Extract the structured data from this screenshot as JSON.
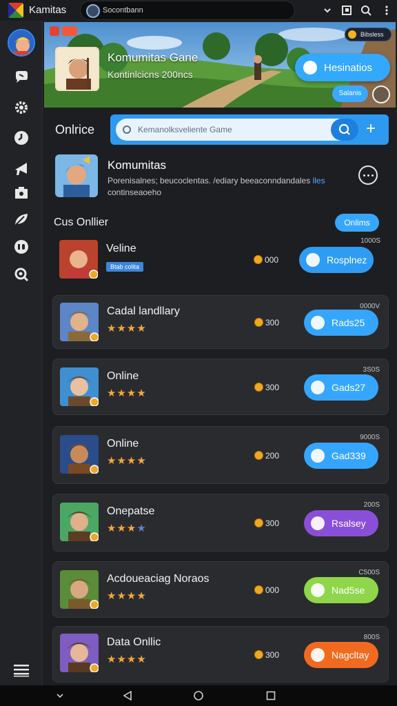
{
  "app": {
    "title": "Kamitas",
    "search_value": "Socontbann"
  },
  "hero": {
    "title": "Komumitas Gane",
    "subtitle": "Kontinlcicns 200ncs",
    "primary_button": "Hesinatios",
    "small_button": "Salanis",
    "coin_label": "Bibsless"
  },
  "search": {
    "section_label": "Onlrice",
    "placeholder": "Kemanolksveliente Game"
  },
  "community": {
    "title": "Komumitas",
    "description": "Porenisalnes; beucoclentas. /ediary beeaconndandales",
    "link": "lles",
    "description_tail": "continseaoeho"
  },
  "list": {
    "title": "Cus Onllier",
    "header_button": "Onlims",
    "items": [
      {
        "name": "Veline",
        "tag": "Btab colita",
        "coins": "000",
        "corner": "1000S",
        "button": "Rosplnez",
        "button_color": "#2f9cf4",
        "stars": ""
      },
      {
        "name": "Cadal landllary",
        "stars": "★★★★",
        "coins": "300",
        "corner": "0000V",
        "button": "Rads25",
        "button_color": "#35a6ff"
      },
      {
        "name": "Online",
        "stars": "★★★★",
        "coins": "300",
        "corner": "3S0S",
        "button": "Gads27",
        "button_color": "#35a6ff"
      },
      {
        "name": "Online",
        "stars": "★★★★",
        "coins": "200",
        "corner": "9000S",
        "button": "Gad339",
        "button_color": "#35a6ff"
      },
      {
        "name": "Onepatse",
        "stars": "★★★",
        "stars_dim": "★",
        "coins": "300",
        "corner": "200S",
        "button": "Rsalsey",
        "button_color": "#8a4fd8"
      },
      {
        "name": "Acdoueaciag Noraos",
        "stars": "★★★★",
        "coins": "000",
        "corner": "C500S",
        "button": "Nad5se",
        "button_color": "#8fd64a"
      },
      {
        "name": "Data Onllic",
        "stars": "★★★★",
        "coins": "300",
        "corner": "800S",
        "button": "Nagcltay",
        "button_color": "#f26a1f"
      }
    ]
  },
  "colors": {
    "accent": "#35a6ff",
    "background": "#1d1e21",
    "card": "#2a2b2f",
    "star": "#f4a83a"
  }
}
